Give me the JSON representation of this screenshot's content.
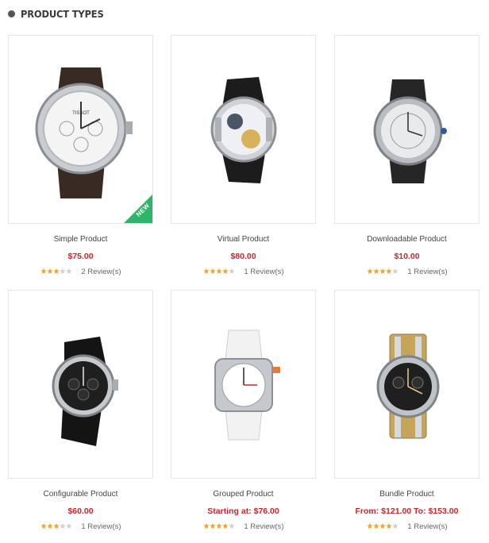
{
  "section": {
    "title": "PRODUCT TYPES"
  },
  "products": [
    {
      "name": "Simple Product",
      "price": "$75.00",
      "rating": 3,
      "reviews": "2 Review(s)",
      "badge": "NEW",
      "watch": "tissot",
      "badge_color": "#2fb56a"
    },
    {
      "name": "Virtual Product",
      "price": "$80.00",
      "rating": 4,
      "reviews": "1 Review(s)",
      "watch": "skeleton"
    },
    {
      "name": "Downloadable Product",
      "price": "$10.00",
      "rating": 4,
      "reviews": "1 Review(s)",
      "watch": "roman"
    },
    {
      "name": "Configurable Product",
      "price": "$60.00",
      "rating": 3,
      "reviews": "1 Review(s)",
      "watch": "black-chrono"
    },
    {
      "name": "Grouped Product",
      "price": "Starting at: $76.00",
      "rating": 4,
      "reviews": "1 Review(s)",
      "watch": "white-diver"
    },
    {
      "name": "Bundle Product",
      "price": "From: $121.00   To: $153.00",
      "rating": 4,
      "reviews": "1 Review(s)",
      "watch": "citizen"
    }
  ],
  "colors": {
    "price": "#d0232a",
    "star": "#f2a21d",
    "star_off": "#cfcfcf"
  }
}
